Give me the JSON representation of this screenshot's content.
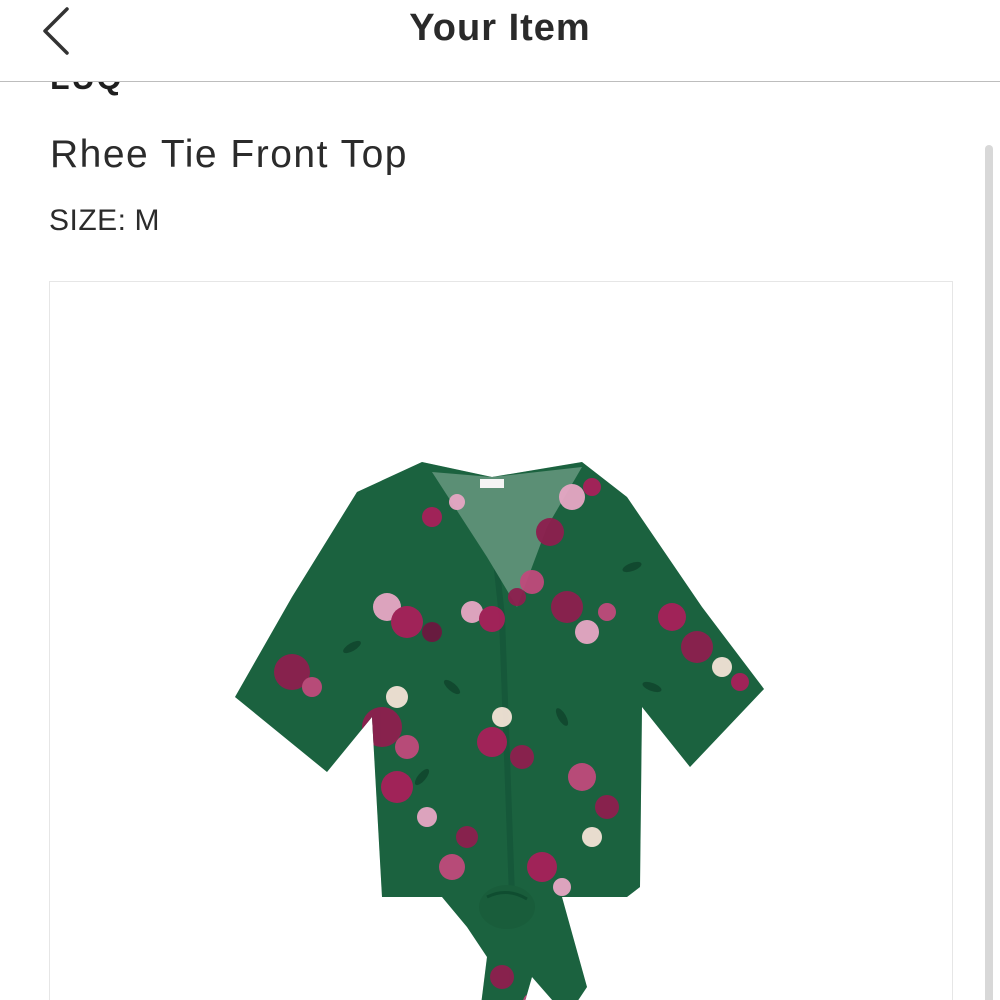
{
  "header": {
    "title": "Your Item",
    "back_icon": "chevron-left-icon"
  },
  "item": {
    "brand": "LUQ",
    "name": "Rhee Tie Front Top",
    "size_label": "SIZE:",
    "size_value": "M",
    "image": {
      "icon": "product-photo",
      "colors": {
        "fabric": "#1f6a45",
        "flower_primary": "#a8205a",
        "flower_secondary": "#e7a7c4",
        "flower_light": "#f3e3d6"
      }
    }
  }
}
